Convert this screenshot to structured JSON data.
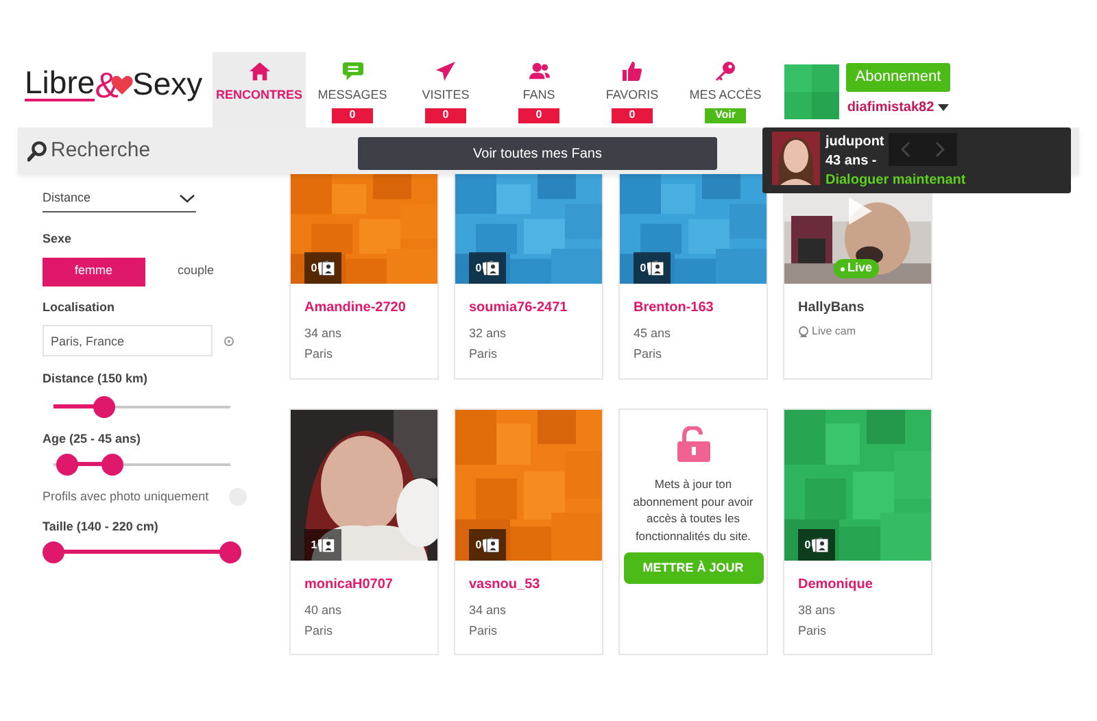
{
  "logo": {
    "left": "Libre",
    "mark": "&",
    "right": "Sexy"
  },
  "nav": [
    {
      "label": "RENCONTRES",
      "selected": true
    },
    {
      "label": "MESSAGES",
      "selected": false,
      "badge": {
        "text": "0",
        "color": "#e8173f"
      }
    },
    {
      "label": "VISITES",
      "selected": false,
      "badge": {
        "text": "0",
        "color": "#e8173f"
      }
    },
    {
      "label": "FANS",
      "selected": false,
      "badge": {
        "text": "0",
        "color": "#e8173f"
      }
    },
    {
      "label": "FAVORIS",
      "selected": false,
      "badge": {
        "text": "0",
        "color": "#e8173f"
      }
    },
    {
      "label": "MES ACCÈS",
      "selected": false,
      "badge": {
        "text": "Voir",
        "color": "#4cbb17"
      }
    }
  ],
  "account": {
    "button": "Abonnement",
    "username": "diafimistak82"
  },
  "search": {
    "label": "Recherche"
  },
  "tooltip": "Voir toutes mes Fans",
  "chat_popup": {
    "name": "judupont",
    "age": "43 ans -",
    "action": "Dialoguer maintenant"
  },
  "filters": {
    "sort": "Distance",
    "sex_label": "Sexe",
    "sex_options": [
      {
        "label": "femme",
        "selected": true
      },
      {
        "label": "couple",
        "selected": false
      }
    ],
    "location_label": "Localisation",
    "location": "Paris, France",
    "distance_label": "Distance (150 km)",
    "distance": {
      "level": 0.29
    },
    "age_label": "Age (25 - 45 ans)",
    "age": {
      "thumbs": [
        {
          "level": 0.08
        },
        {
          "level": 0.33
        }
      ]
    },
    "photo_only_label": "Profils avec photo uniquement",
    "photo_only": {
      "on": false
    },
    "height_label": "Taille (140 - 220 cm)",
    "height": {
      "thumbs": [
        {
          "level": 0
        },
        {
          "level": 1
        }
      ]
    }
  },
  "cards": [
    {
      "kind": "profile",
      "name": "Amandine-2720",
      "age": "34 ans",
      "city": "Paris",
      "photos": "0"
    },
    {
      "kind": "profile",
      "name": "soumia76-2471",
      "age": "32 ans",
      "city": "Paris",
      "photos": "0"
    },
    {
      "kind": "profile",
      "name": "Brenton-163",
      "age": "45 ans",
      "city": "Paris",
      "photos": "0"
    },
    {
      "kind": "live",
      "name": "HallyBans",
      "badge": "Live",
      "subtitle": "Live cam"
    },
    {
      "kind": "profile",
      "name": "monicaH0707",
      "age": "40 ans",
      "city": "Paris",
      "photos": "1"
    },
    {
      "kind": "profile",
      "name": "vasnou_53",
      "age": "34 ans",
      "city": "Paris",
      "photos": "0"
    },
    {
      "kind": "upgrade",
      "text": "Mets à jour ton abonnement pour avoir accès à toutes les fonctionnalités du site.",
      "button": "METTRE À JOUR"
    },
    {
      "kind": "profile",
      "name": "Demonique",
      "age": "38 ans",
      "city": "Paris",
      "photos": "0"
    }
  ]
}
